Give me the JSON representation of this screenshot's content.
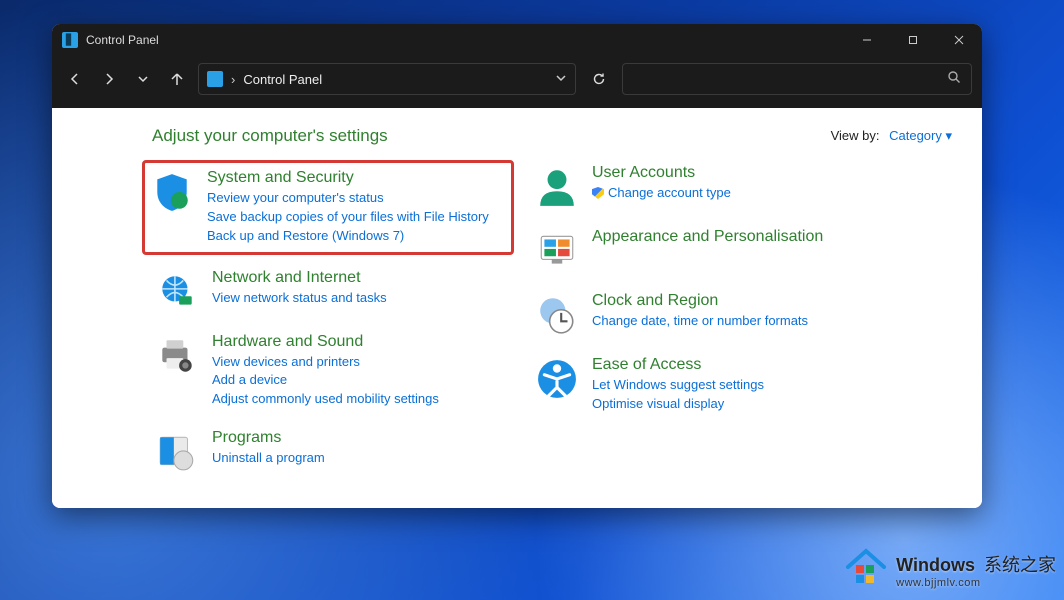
{
  "window": {
    "title": "Control Panel"
  },
  "nav": {
    "address_label": "Control Panel"
  },
  "content": {
    "heading": "Adjust your computer's settings",
    "viewby_label": "View by:",
    "viewby_value": "Category"
  },
  "left": {
    "system_security": {
      "title": "System and Security",
      "link1": "Review your computer's status",
      "link2": "Save backup copies of your files with File History",
      "link3": "Back up and Restore (Windows 7)"
    },
    "network": {
      "title": "Network and Internet",
      "link1": "View network status and tasks"
    },
    "hardware": {
      "title": "Hardware and Sound",
      "link1": "View devices and printers",
      "link2": "Add a device",
      "link3": "Adjust commonly used mobility settings"
    },
    "programs": {
      "title": "Programs",
      "link1": "Uninstall a program"
    }
  },
  "right": {
    "users": {
      "title": "User Accounts",
      "link1": "Change account type"
    },
    "appearance": {
      "title": "Appearance and Personalisation"
    },
    "clock": {
      "title": "Clock and Region",
      "link1": "Change date, time or number formats"
    },
    "ease": {
      "title": "Ease of Access",
      "link1": "Let Windows suggest settings",
      "link2": "Optimise visual display"
    }
  },
  "watermark": {
    "brand": "Windows",
    "tagline": "系统之家",
    "url": "www.bjjmlv.com"
  }
}
